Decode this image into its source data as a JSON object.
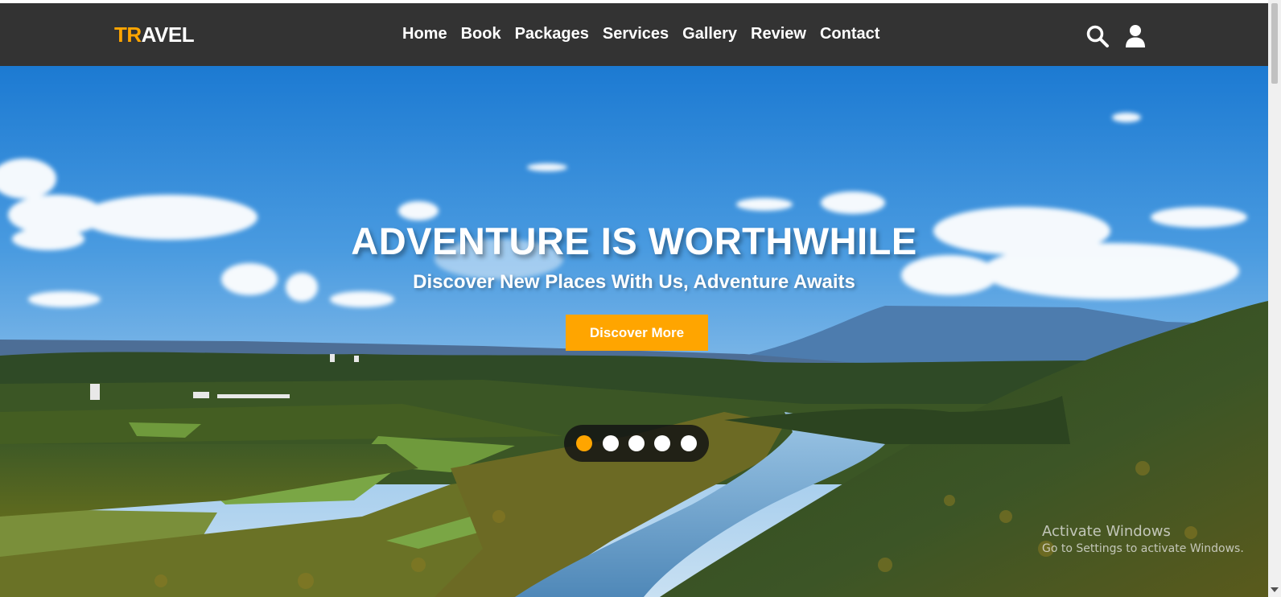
{
  "header": {
    "logo_accent": "TR",
    "logo_rest": "AVEL",
    "nav": [
      "Home",
      "Book",
      "Packages",
      "Services",
      "Gallery",
      "Review",
      "Contact"
    ],
    "icons": [
      "search-icon",
      "user-icon"
    ]
  },
  "hero": {
    "title": "ADVENTURE IS WORTHWHILE",
    "subtitle": "Discover New Places With Us, Adventure Awaits",
    "cta_label": "Discover More",
    "slides": 5,
    "active_slide": 1
  },
  "watermark": {
    "title": "Activate Windows",
    "subtitle": "Go to Settings to activate Windows."
  },
  "colors": {
    "header_bg": "#333333",
    "accent": "#ffa500",
    "text": "#ffffff"
  }
}
